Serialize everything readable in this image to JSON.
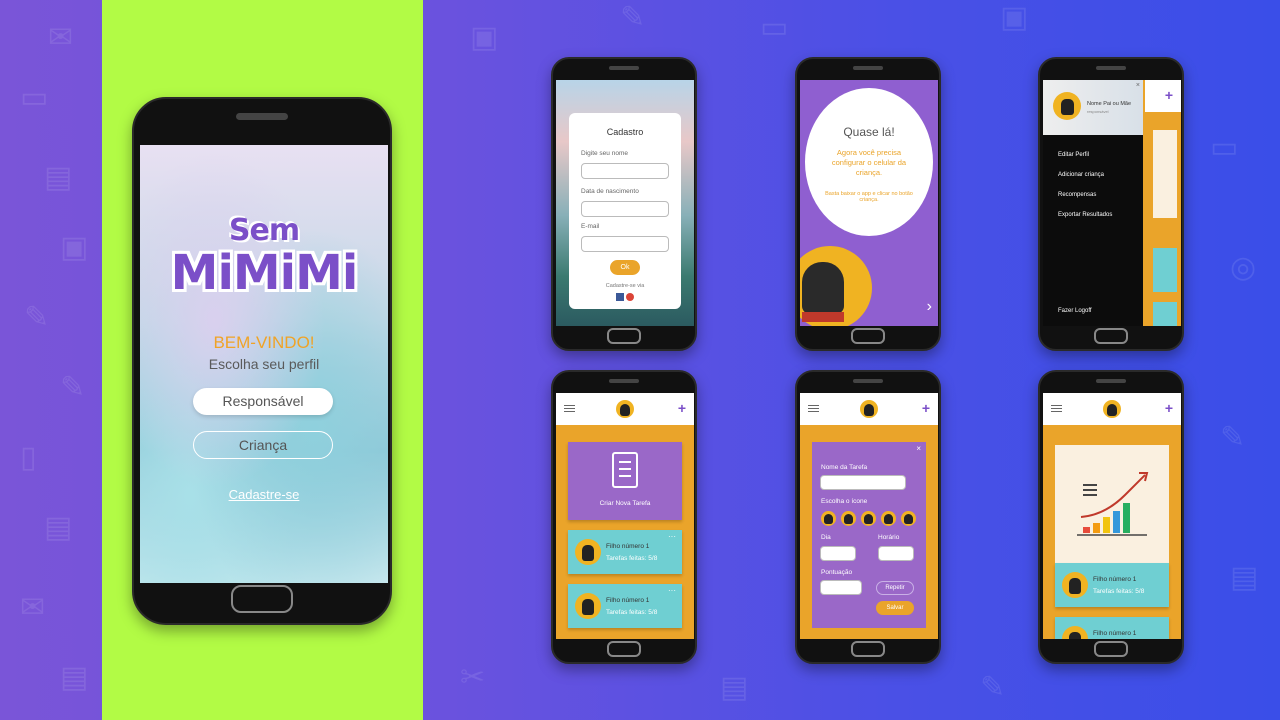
{
  "welcome_screen": {
    "logo_line1": "Sem",
    "logo_line2": "MiMiMi",
    "greeting": "BEM-VINDO!",
    "subtitle": "Escolha seu perfil",
    "btn_responsavel": "Responsável",
    "btn_crianca": "Criança",
    "link_cadastre": "Cadastre-se"
  },
  "signup_screen": {
    "title": "Cadastro",
    "label_name": "Digite seu nome",
    "label_birth": "Data de nascimento",
    "label_email": "E-mail",
    "btn_ok": "Ok",
    "alt_signup": "Cadastre-se via"
  },
  "almost_screen": {
    "title": "Quase lá!",
    "body": "Agora você precisa configurar o celular da criança.",
    "hint": "Basta baixar o app e clicar no botão criança."
  },
  "menu_screen": {
    "user_name": "Nome Pai ou Mãe",
    "user_sub": "responsável",
    "items": [
      "Editar Perfil",
      "Adicionar criança",
      "Recompensas",
      "Exportar Resultados"
    ],
    "logoff": "Fazer Logoff"
  },
  "tasks_screen": {
    "create_task": "Criar Nova Tarefa",
    "kids": [
      {
        "name": "Filho número 1",
        "tasks": "Tarefas feitas: 5/8"
      },
      {
        "name": "Filho número 1",
        "tasks": "Tarefas feitas: 5/8"
      }
    ]
  },
  "newtask_screen": {
    "label_task": "Nome da Tarefa",
    "label_icon": "Escolha o ícone",
    "label_day": "Dia",
    "label_time": "Horário",
    "label_score": "Pontuação",
    "btn_repeat": "Repetir",
    "btn_save": "Salvar"
  },
  "progress_screen": {
    "kids": [
      {
        "name": "Filho número 1",
        "tasks": "Tarefas feitas: 5/8"
      },
      {
        "name": "Filho número 1"
      }
    ]
  },
  "colors": {
    "purple": "#7b4fc8",
    "orange": "#eaa42a",
    "teal": "#6fcfd2",
    "lime": "#b2fb45"
  }
}
